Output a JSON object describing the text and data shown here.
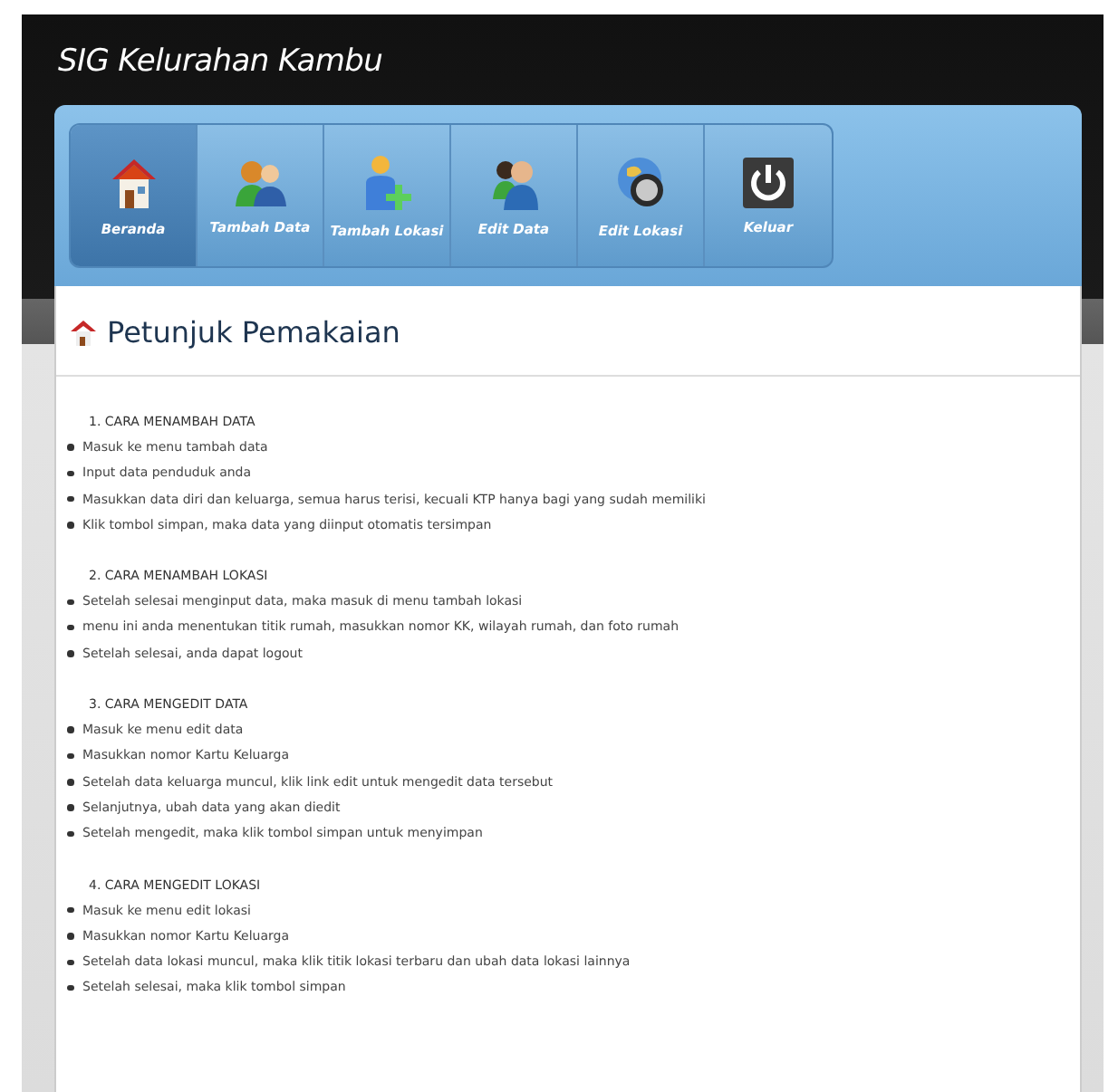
{
  "site_title": "SIG Kelurahan Kambu",
  "nav": [
    {
      "label": "Beranda",
      "kind": "home",
      "selected": true
    },
    {
      "label": "Tambah Data",
      "kind": "people",
      "selected": false
    },
    {
      "label": "Tambah Lokasi",
      "kind": "adduser",
      "selected": false
    },
    {
      "label": "Edit Data",
      "kind": "pair",
      "selected": false
    },
    {
      "label": "Edit Lokasi",
      "kind": "globe",
      "selected": false
    },
    {
      "label": "Keluar",
      "kind": "power",
      "selected": false
    }
  ],
  "page_title": "Petunjuk Pemakaian",
  "sections": [
    {
      "heading": "1. CARA MENAMBAH DATA",
      "items": [
        "Masuk ke menu tambah data",
        "Input data penduduk anda",
        "Masukkan data diri dan keluarga, semua harus terisi, kecuali KTP hanya bagi yang sudah memiliki",
        "Klik tombol simpan, maka data yang diinput otomatis tersimpan"
      ]
    },
    {
      "heading": "2. CARA MENAMBAH LOKASI",
      "items": [
        "Setelah selesai menginput data, maka masuk di menu tambah lokasi",
        "menu ini anda menentukan titik rumah, masukkan nomor KK, wilayah rumah, dan foto rumah",
        "Setelah selesai, anda dapat logout"
      ]
    },
    {
      "heading": "3. CARA MENGEDIT DATA",
      "items": [
        "Masuk ke menu edit data",
        "Masukkan nomor Kartu Keluarga",
        "Setelah data keluarga muncul, klik link edit untuk mengedit data tersebut",
        "Selanjutnya, ubah data yang akan diedit",
        "Setelah mengedit, maka klik tombol simpan untuk menyimpan"
      ]
    },
    {
      "heading": "4. CARA MENGEDIT LOKASI",
      "items": [
        "Masuk ke menu edit lokasi",
        "Masukkan nomor Kartu Keluarga",
        "Setelah data lokasi muncul, maka klik titik lokasi terbaru dan ubah data lokasi lainnya",
        "Setelah selesai, maka klik tombol simpan"
      ]
    }
  ]
}
